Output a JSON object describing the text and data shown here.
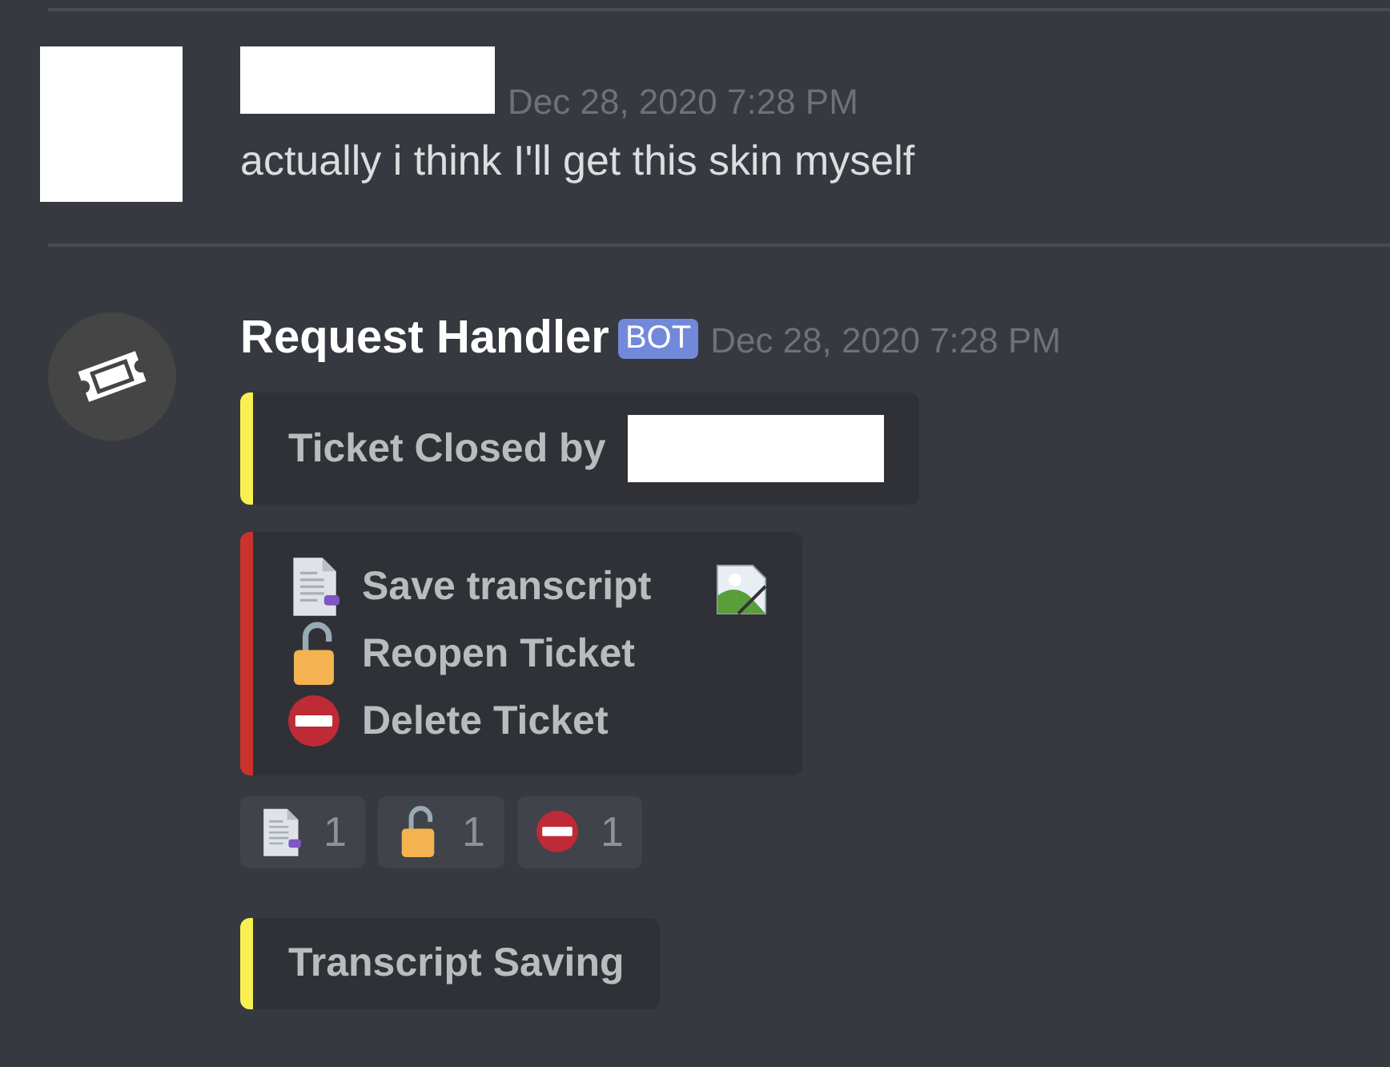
{
  "messages": [
    {
      "kind": "user",
      "redacted_name": true,
      "timestamp": "Dec 28, 2020 7:28 PM",
      "text": "actually i think I'll get this skin myself"
    },
    {
      "kind": "bot",
      "author": "Request Handler",
      "badge": "BOT",
      "timestamp": "Dec 28, 2020 7:28 PM",
      "embeds": [
        {
          "color": "#f8f050",
          "text": "Ticket Closed by",
          "redacted_mention": true
        },
        {
          "color": "#c8342c",
          "lines": [
            {
              "kind": "document",
              "text": "Save transcript"
            },
            {
              "kind": "unlock",
              "text": "Reopen Ticket"
            },
            {
              "kind": "no-entry",
              "text": "Delete Ticket"
            }
          ],
          "thumbnail": {
            "kind": "broken-image"
          }
        }
      ],
      "reactions": [
        {
          "kind": "document",
          "count": "1"
        },
        {
          "kind": "unlock",
          "count": "1"
        },
        {
          "kind": "no-entry",
          "count": "1"
        }
      ]
    },
    {
      "kind": "continuation",
      "embeds": [
        {
          "color": "#f8f050",
          "text": "Transcript Saving"
        }
      ]
    }
  ]
}
